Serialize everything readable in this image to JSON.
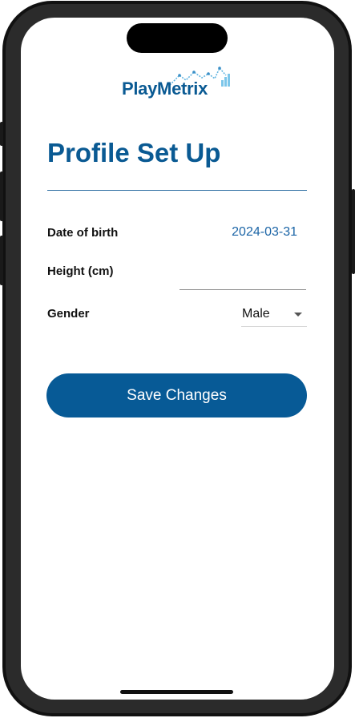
{
  "app": {
    "brand_name": "PlayMetrix",
    "brand_color": "#0a5a93",
    "accent_color": "#1a64a6"
  },
  "page": {
    "title": "Profile Set Up"
  },
  "form": {
    "dob": {
      "label": "Date of birth",
      "value": "2024-03-31"
    },
    "height": {
      "label": "Height (cm)",
      "value": ""
    },
    "gender": {
      "label": "Gender",
      "value": "Male"
    }
  },
  "actions": {
    "save_label": "Save Changes"
  },
  "icons": {
    "dropdown": "chevron-down-icon",
    "logo_graph": "line-chart-icon"
  }
}
